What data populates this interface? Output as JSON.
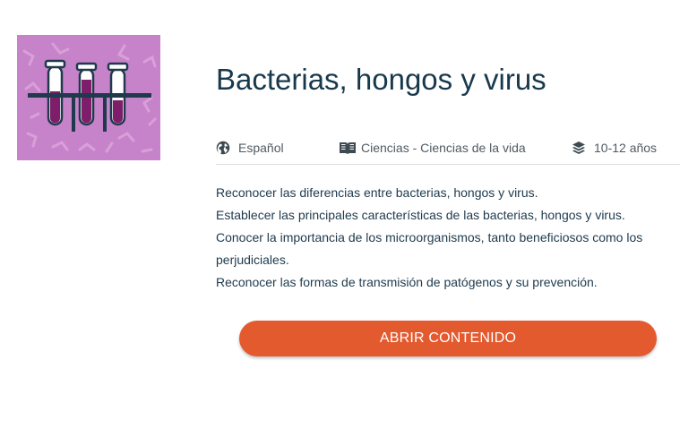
{
  "card": {
    "thumbnail_icon": "test-tubes-rack-icon",
    "thumbnail_bg": "#c783c9",
    "title": "Bacterias, hongos y virus",
    "meta": {
      "language": {
        "icon": "globe-icon",
        "label": "Español"
      },
      "subject": {
        "icon": "open-book-icon",
        "label": "Ciencias - Ciencias de la vida"
      },
      "age": {
        "icon": "layers-icon",
        "label": "10-12 años"
      }
    },
    "objectives": [
      "Reconocer las diferencias entre bacterias, hongos y virus.",
      "Establecer las principales características de las bacterias, hongos y virus.",
      "Conocer la importancia de los microorganismos, tanto beneficiosos como los perjudiciales.",
      "Reconocer las formas de transmisión de patógenos y su prevención."
    ],
    "button_label": "ABRIR CONTENIDO",
    "accent_color": "#e35a2f"
  }
}
